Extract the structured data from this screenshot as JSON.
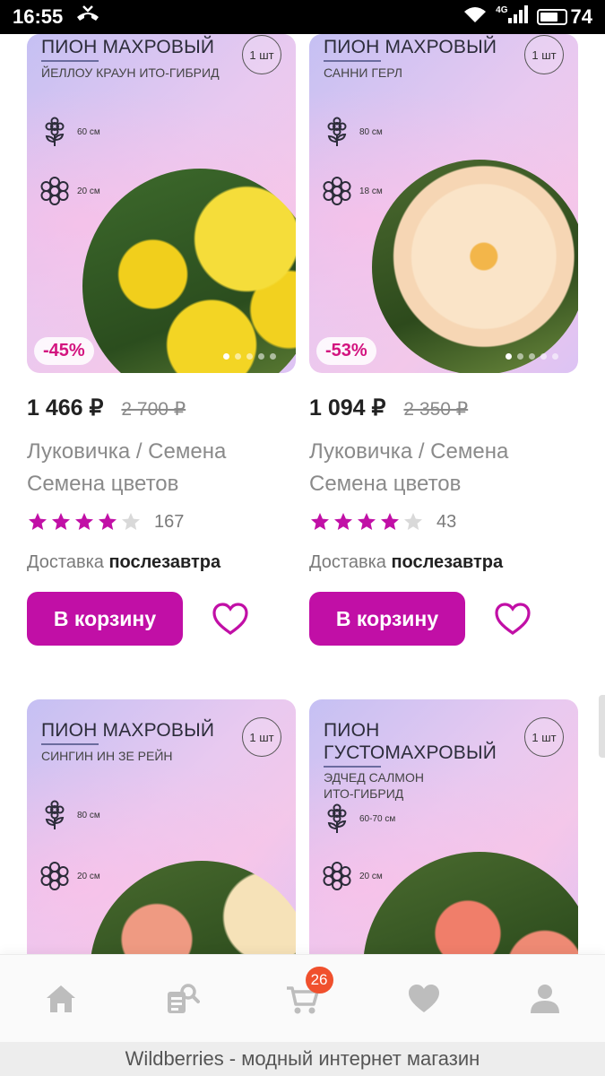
{
  "status_bar": {
    "time": "16:55",
    "network": "4G",
    "battery": "74"
  },
  "products": [
    {
      "title": "ПИОН МАХРОВЫЙ",
      "subtitle": "ЙЕЛЛОУ КРАУН ИТО-ГИБРИД",
      "qty": "1 шт",
      "height": "60 см",
      "flower_size": "20 см",
      "flower_color": "#f2d21a",
      "discount": "-45%",
      "price": "1 466 ₽",
      "old_price": "2 700 ₽",
      "brand": "Луковичка / Семена",
      "name": "Семена цветов",
      "rating": 4,
      "reviews": "167",
      "delivery_label": "Доставка",
      "delivery_value": "послезавтра",
      "cart_label": "В корзину"
    },
    {
      "title": "ПИОН МАХРОВЫЙ",
      "subtitle": "САННИ ГЕРЛ",
      "qty": "1 шт",
      "height": "80 см",
      "flower_size": "18 см",
      "flower_color": "#f7dcc0",
      "discount": "-53%",
      "price": "1 094 ₽",
      "old_price": "2 350 ₽",
      "brand": "Луковичка / Семена",
      "name": "Семена цветов",
      "rating": 4,
      "reviews": "43",
      "delivery_label": "Доставка",
      "delivery_value": "послезавтра",
      "cart_label": "В корзину"
    },
    {
      "title": "ПИОН МАХРОВЫЙ",
      "subtitle": "СИНГИН ИН ЗЕ РЕЙН",
      "qty": "1 шт",
      "height": "80 см",
      "flower_size": "20 см",
      "flower_color": "#f2a98a"
    },
    {
      "title": "ПИОН ГУСТОМАХРОВЫЙ",
      "subtitle": "ЭДЧЕД САЛМОН ИТО-ГИБРИД",
      "qty": "1 шт",
      "height": "60-70 см",
      "flower_size": "20 см",
      "flower_color": "#f08a78"
    }
  ],
  "bottom_nav": {
    "items": [
      "home-icon",
      "catalog-search-icon",
      "cart-icon",
      "heart-icon",
      "profile-icon"
    ],
    "cart_badge": "26",
    "accent": "#c10fa6"
  },
  "footer": {
    "text": "Wildberries - модный интернет магазин"
  }
}
